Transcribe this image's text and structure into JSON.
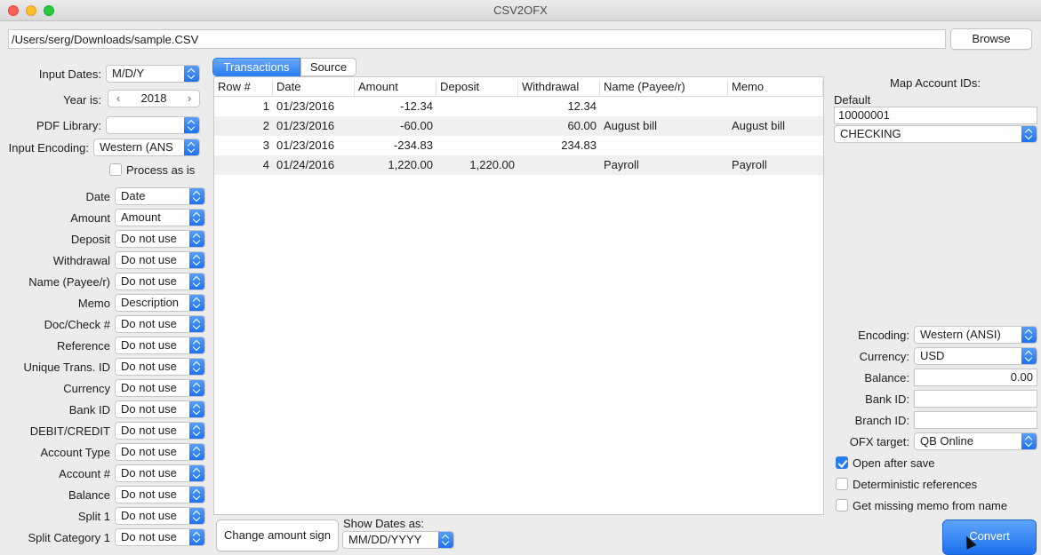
{
  "window": {
    "title": "CSV2OFX"
  },
  "path": {
    "value": "/Users/serg/Downloads/sample.CSV",
    "browse_label": "Browse"
  },
  "left_panel": {
    "input_dates": {
      "label": "Input Dates:",
      "value": "M/D/Y"
    },
    "year": {
      "label": "Year is:",
      "value": "2018"
    },
    "pdf_library": {
      "label": "PDF Library:",
      "value": ""
    },
    "input_encoding": {
      "label": "Input Encoding:",
      "value": "Western (ANS"
    },
    "process_as_is": {
      "label": "Process as is",
      "checked": false
    },
    "mappings": [
      {
        "label": "Date",
        "value": "Date"
      },
      {
        "label": "Amount",
        "value": "Amount"
      },
      {
        "label": "Deposit",
        "value": "Do not use"
      },
      {
        "label": "Withdrawal",
        "value": "Do not use"
      },
      {
        "label": "Name (Payee/r)",
        "value": "Do not use"
      },
      {
        "label": "Memo",
        "value": "Description"
      },
      {
        "label": "Doc/Check #",
        "value": "Do not use"
      },
      {
        "label": "Reference",
        "value": "Do not use"
      },
      {
        "label": "Unique Trans. ID",
        "value": "Do not use"
      },
      {
        "label": "Currency",
        "value": "Do not use"
      },
      {
        "label": "Bank ID",
        "value": "Do not use"
      },
      {
        "label": "DEBIT/CREDIT",
        "value": "Do not use"
      },
      {
        "label": "Account Type",
        "value": "Do not use"
      },
      {
        "label": "Account #",
        "value": "Do not use"
      },
      {
        "label": "Balance",
        "value": "Do not use"
      },
      {
        "label": "Split 1",
        "value": "Do not use"
      },
      {
        "label": "Split Category 1",
        "value": "Do not use"
      }
    ]
  },
  "tabs": [
    {
      "label": "Transactions"
    },
    {
      "label": "Source"
    }
  ],
  "table": {
    "columns": [
      "Row #",
      "Date",
      "Amount",
      "Deposit",
      "Withdrawal",
      "Name (Payee/r)",
      "Memo"
    ],
    "rows": [
      [
        "1",
        "01/23/2016",
        "-12.34",
        "",
        "12.34",
        "",
        ""
      ],
      [
        "2",
        "01/23/2016",
        "-60.00",
        "",
        "60.00",
        "August bill",
        "August bill"
      ],
      [
        "3",
        "01/23/2016",
        "-234.83",
        "",
        "234.83",
        "",
        ""
      ],
      [
        "4",
        "01/24/2016",
        "1,220.00",
        "1,220.00",
        "",
        "Payroll",
        "Payroll"
      ]
    ]
  },
  "bottom": {
    "change_sign_label": "Change amount sign",
    "show_dates_label": "Show Dates as:",
    "show_dates_value": "MM/DD/YYYY"
  },
  "right_panel": {
    "title": "Map Account IDs:",
    "default_label": "Default",
    "account_id": "10000001",
    "account_type": "CHECKING",
    "encoding": {
      "label": "Encoding:",
      "value": "Western (ANSI)"
    },
    "currency": {
      "label": "Currency:",
      "value": "USD"
    },
    "balance": {
      "label": "Balance:",
      "value": "0.00"
    },
    "bank_id": {
      "label": "Bank ID:",
      "value": ""
    },
    "branch_id": {
      "label": "Branch ID:",
      "value": ""
    },
    "ofx_target": {
      "label": "OFX target:",
      "value": "QB Online"
    },
    "open_after_save": {
      "label": "Open after save",
      "checked": true
    },
    "deterministic": {
      "label": "Deterministic references",
      "checked": false
    },
    "missing_memo": {
      "label": "Get missing memo from name",
      "checked": false
    },
    "convert_label": "Convert"
  }
}
